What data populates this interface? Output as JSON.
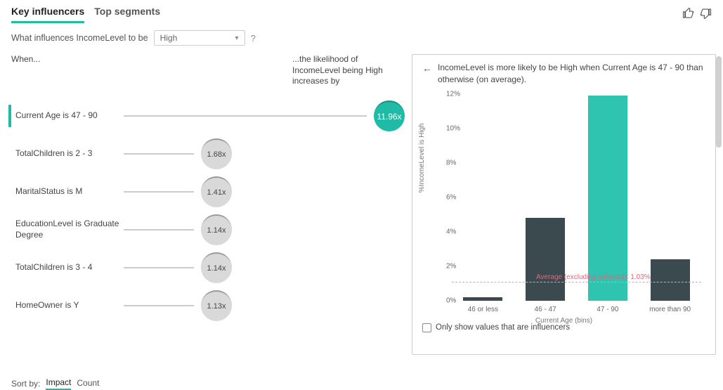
{
  "tabs": {
    "key_influencers": "Key influencers",
    "top_segments": "Top segments"
  },
  "question": {
    "prefix": "What influences IncomeLevel to be",
    "selected": "High",
    "help": "?"
  },
  "columns": {
    "when": "When...",
    "likelihood": "...the likelihood of IncomeLevel being High increases by"
  },
  "influencers": [
    {
      "label": "Current Age is 47 - 90",
      "factor": "11.96x",
      "selected": true
    },
    {
      "label": "TotalChildren is 2 - 3",
      "factor": "1.68x",
      "selected": false
    },
    {
      "label": "MaritalStatus is M",
      "factor": "1.41x",
      "selected": false
    },
    {
      "label": "EducationLevel is Graduate Degree",
      "factor": "1.14x",
      "selected": false
    },
    {
      "label": "TotalChildren is 3 - 4",
      "factor": "1.14x",
      "selected": false
    },
    {
      "label": "HomeOwner is Y",
      "factor": "1.13x",
      "selected": false
    }
  ],
  "sort": {
    "label": "Sort by:",
    "impact": "Impact",
    "count": "Count"
  },
  "detail": {
    "back_icon": "←",
    "headline": "IncomeLevel is more likely to be High when Current Age is 47 - 90 than otherwise (on average).",
    "checkbox_label": "Only show values that are influencers"
  },
  "chart_data": {
    "type": "bar",
    "title": "",
    "xlabel": "Current Age (bins)",
    "ylabel": "%IncomeLevel is High",
    "ylim": [
      0,
      12
    ],
    "yticks": [
      "0%",
      "2%",
      "4%",
      "6%",
      "8%",
      "10%",
      "12%"
    ],
    "categories": [
      "46 or less",
      "46 - 47",
      "47 - 90",
      "more than 90"
    ],
    "values": [
      0.2,
      4.8,
      11.9,
      2.4
    ],
    "highlight_index": 2,
    "reference_line": {
      "value": 1.03,
      "label": "Average (excluding selected): 1.03%"
    }
  }
}
